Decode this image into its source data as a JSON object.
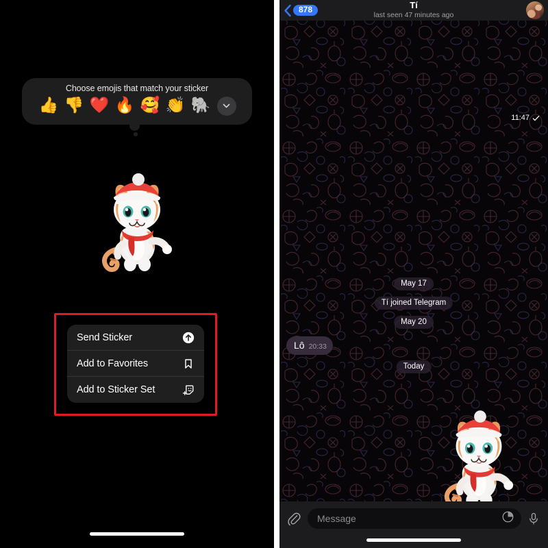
{
  "left": {
    "emoji_panel": {
      "title": "Choose emojis that match your sticker",
      "emojis": [
        {
          "name": "thumbs-up-emoji",
          "glyph": "👍"
        },
        {
          "name": "thumbs-down-emoji",
          "glyph": "👎"
        },
        {
          "name": "red-heart-emoji",
          "glyph": "❤️"
        },
        {
          "name": "fire-emoji",
          "glyph": "🔥"
        },
        {
          "name": "smiling-face-with-hearts-emoji",
          "glyph": "🥰"
        },
        {
          "name": "clapping-hands-emoji",
          "glyph": "👏"
        },
        {
          "name": "elephant-emoji",
          "glyph": "🐘"
        }
      ],
      "expand_icon": "chevron-down-icon"
    },
    "sticker": {
      "name": "cat-santa-sticker",
      "description": "3D orange and white kitten wearing a red Santa hat and red scarf"
    },
    "context_menu": {
      "items": [
        {
          "label": "Send Sticker",
          "icon": "send-arrow-up-icon"
        },
        {
          "label": "Add to Favorites",
          "icon": "bookmark-icon"
        },
        {
          "label": "Add to Sticker Set",
          "icon": "add-sticker-icon"
        }
      ]
    },
    "annotation": {
      "name": "red-highlight-box",
      "color": "#e01b24"
    },
    "home_indicator": "home-indicator"
  },
  "right": {
    "header": {
      "back_label": "878",
      "back_icon": "chevron-left-icon",
      "title": "Tí",
      "subtitle": "last seen 47 minutes ago",
      "avatar": "contact-avatar"
    },
    "messages": [
      {
        "type": "service",
        "text": "May 17",
        "name": "date-divider-may-17"
      },
      {
        "type": "service",
        "text": "Tí joined Telegram",
        "name": "service-joined-telegram"
      },
      {
        "type": "service",
        "text": "May 20",
        "name": "date-divider-may-20"
      },
      {
        "type": "incoming",
        "text": "Lô",
        "time": "20:33",
        "name": "incoming-message-lo"
      },
      {
        "type": "service",
        "text": "Today",
        "name": "date-divider-today"
      },
      {
        "type": "sticker",
        "time": "11:47",
        "status": "✓",
        "name": "outgoing-sticker-message"
      }
    ],
    "input": {
      "placeholder": "Message",
      "attach_icon": "paperclip-icon",
      "sticker_icon": "sticker-icon",
      "mic_icon": "microphone-icon"
    },
    "colors": {
      "accent_blue": "#3478f6",
      "header_bg": "#1c1c1e",
      "bubble_in": "#362c3c"
    }
  }
}
